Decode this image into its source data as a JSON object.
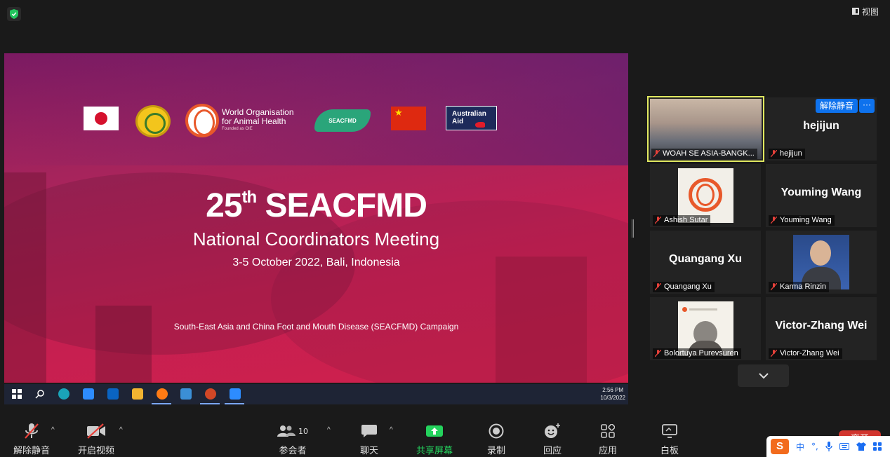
{
  "top": {
    "view_label": "视图"
  },
  "slide": {
    "woah_line1": "World Organisation",
    "woah_line2": "for Animal Health",
    "woah_founded": "Founded as OIE",
    "seacfmd_logo": "SEACFMD",
    "aus_line1": "Australian",
    "aus_line2": "Aid",
    "title_prefix": "25",
    "title_sup": "th",
    "title_rest": " SEACFMD",
    "subtitle": "National Coordinators Meeting",
    "date": "3-5 October 2022, Bali, Indonesia",
    "campaign": "South-East Asia and China Foot and Mouth Disease (SEACFMD) Campaign"
  },
  "taskbar": {
    "time": "2:56 PM",
    "date": "10/3/2022"
  },
  "participants": {
    "unmute_label": "解除静音",
    "more_label": "···",
    "tiles": [
      {
        "label": "WOAH SE ASIA-BANGK...",
        "big_name": ""
      },
      {
        "label": "hejijun",
        "big_name": "hejijun"
      },
      {
        "label": "Ashish Sutar",
        "big_name": ""
      },
      {
        "label": "Youming Wang",
        "big_name": "Youming Wang"
      },
      {
        "label": "Quangang Xu",
        "big_name": "Quangang Xu"
      },
      {
        "label": "Karma Rinzin",
        "big_name": ""
      },
      {
        "label": "Bolortuya Purevsuren",
        "big_name": ""
      },
      {
        "label": "Victor-Zhang Wei",
        "big_name": "Victor-Zhang Wei"
      }
    ]
  },
  "toolbar": {
    "unmute": "解除静音",
    "start_video": "开启视频",
    "participants": "参会者",
    "participants_count": "10",
    "chat": "聊天",
    "share": "共享屏幕",
    "record": "录制",
    "reactions": "回应",
    "apps": "应用",
    "whiteboard": "白板",
    "leave": "离开"
  },
  "ime": {
    "logo": "S",
    "mode": "中",
    "punct": "°,"
  },
  "colors": {
    "accent": "#0e72ed",
    "share_green": "#24d35d",
    "leave_red": "#d1352e",
    "speaker_outline": "#e0e860"
  }
}
